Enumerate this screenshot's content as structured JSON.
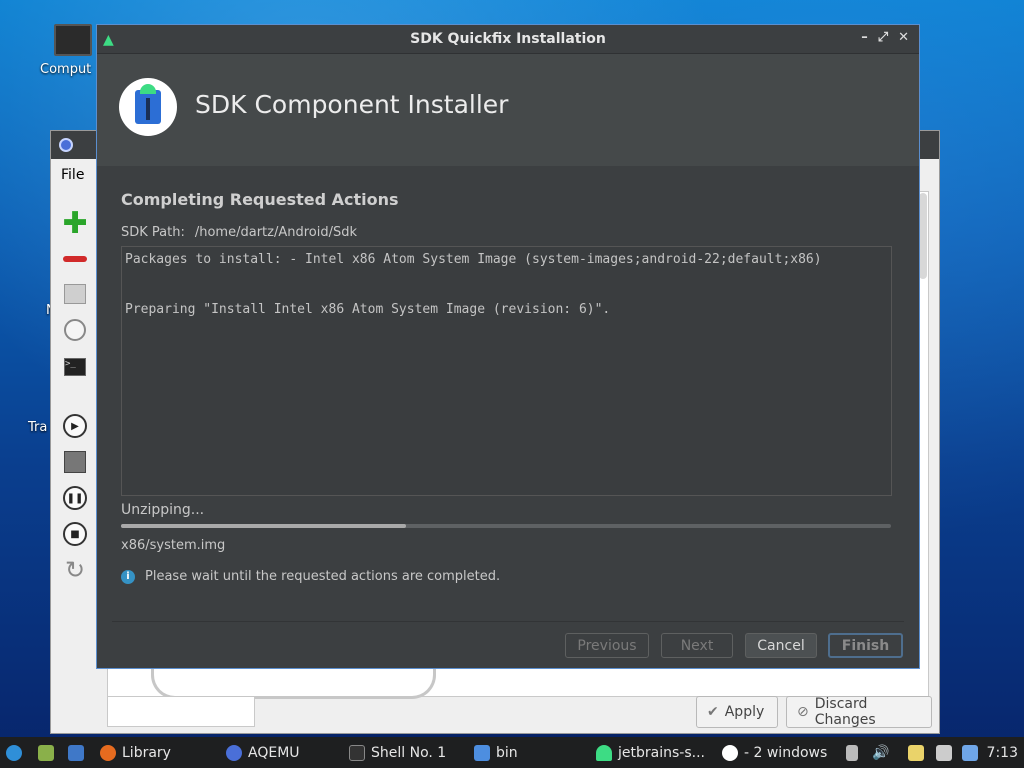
{
  "desktop": {
    "computer_label": "Comput",
    "partial_label_1": "N",
    "partial_label_2": "Tra"
  },
  "aqemu": {
    "menu_file": "File",
    "apply_label": "Apply",
    "discard_label": "Discard Changes"
  },
  "dialog": {
    "title": "SDK Quickfix Installation",
    "header_title": "SDK Component Installer",
    "section_title": "Completing Requested Actions",
    "sdk_path_label": "SDK Path:",
    "sdk_path_value": "/home/dartz/Android/Sdk",
    "log_lines": [
      "Packages to install: - Intel x86 Atom System Image (system-images;android-22;default;x86)",
      "Preparing \"Install Intel x86 Atom System Image (revision: 6)\"."
    ],
    "status": "Unzipping...",
    "progress": 0.37,
    "current_file": "x86/system.img",
    "info": "Please wait until the requested actions are completed.",
    "buttons": {
      "previous": "Previous",
      "next": "Next",
      "cancel": "Cancel",
      "finish": "Finish"
    }
  },
  "taskbar": {
    "library": "Library",
    "aqemu": "AQEMU",
    "shell": "Shell No. 1",
    "bin": "bin",
    "jetbrains": "jetbrains-s...",
    "windows": "- 2 windows",
    "clock": "7:13"
  },
  "colors": {
    "dialog_bg": "#3c3f41",
    "header_bg": "#45494a",
    "android_green": "#3ddc84",
    "accent_blue": "#3592c4"
  }
}
